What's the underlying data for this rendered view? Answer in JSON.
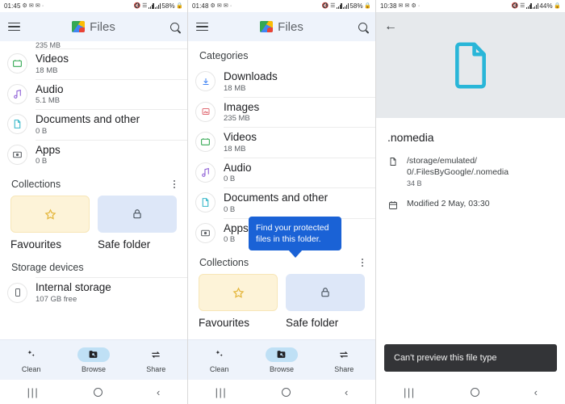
{
  "panel1": {
    "status": {
      "time": "01:45",
      "battery": "58%",
      "icons": [
        "alarm-icon",
        "message-icon",
        "message-icon",
        "dot-icon",
        "mute-icon",
        "wifi-icon",
        "signal-icon",
        "signal-icon",
        "battery-icon"
      ]
    },
    "appbar": {
      "menu": "menu-icon",
      "brand": "Files",
      "search": "search-icon"
    },
    "clipped_size": "235 MB",
    "categories": [
      {
        "title": "Videos",
        "size": "18 MB",
        "icon": "video-icon"
      },
      {
        "title": "Audio",
        "size": "5.1 MB",
        "icon": "audio-icon"
      },
      {
        "title": "Documents and other",
        "size": "0 B",
        "icon": "document-icon"
      },
      {
        "title": "Apps",
        "size": "0 B",
        "icon": "apps-icon"
      }
    ],
    "collections": {
      "title": "Collections",
      "menu": "overflow-menu-icon",
      "cards": [
        {
          "label": "Favourites",
          "icon": "star-icon"
        },
        {
          "label": "Safe folder",
          "icon": "lock-icon"
        }
      ]
    },
    "storage": {
      "title": "Storage devices",
      "items": [
        {
          "title": "Internal storage",
          "sub": "107 GB free",
          "icon": "phone-icon"
        }
      ]
    },
    "bottom_nav": [
      {
        "label": "Clean",
        "icon": "sparkle-icon",
        "selected": false
      },
      {
        "label": "Browse",
        "icon": "folder-search-icon",
        "selected": true
      },
      {
        "label": "Share",
        "icon": "share-arrows-icon",
        "selected": false
      }
    ],
    "sysnav": {
      "recent": "|||",
      "home": "home-icon",
      "back": "‹"
    }
  },
  "panel2": {
    "status": {
      "time": "01:48",
      "battery": "58%"
    },
    "appbar": {
      "brand": "Files"
    },
    "section_title": "Categories",
    "categories": [
      {
        "title": "Downloads",
        "size": "18 MB",
        "icon": "download-icon"
      },
      {
        "title": "Images",
        "size": "235 MB",
        "icon": "image-icon"
      },
      {
        "title": "Videos",
        "size": "18 MB",
        "icon": "video-icon"
      },
      {
        "title": "Audio",
        "size": "0 B",
        "icon": "audio-icon"
      },
      {
        "title": "Documents and other",
        "size": "0 B",
        "icon": "document-icon"
      },
      {
        "title": "Apps",
        "size": "0 B",
        "icon": "apps-icon"
      }
    ],
    "tooltip": "Find your protected files in this folder.",
    "collections": {
      "title": "Collections",
      "menu": "overflow-menu-icon",
      "cards": [
        {
          "label": "Favourites",
          "icon": "star-icon"
        },
        {
          "label": "Safe folder",
          "icon": "lock-icon"
        }
      ]
    },
    "bottom_nav": [
      {
        "label": "Clean",
        "icon": "sparkle-icon",
        "selected": false
      },
      {
        "label": "Browse",
        "icon": "folder-search-icon",
        "selected": true
      },
      {
        "label": "Share",
        "icon": "share-arrows-icon",
        "selected": false
      }
    ]
  },
  "panel3": {
    "status": {
      "time": "10:38",
      "battery": "44%"
    },
    "back": "back-arrow-icon",
    "preview_icon": "document-outline-icon",
    "file_name": ".nomedia",
    "path_line1": "/storage/emulated/",
    "path_line2": "0/.FilesByGoogle/.nomedia",
    "file_size": "34 B",
    "modified": "Modified 2 May, 03:30",
    "snackbar": "Can't preview this file type"
  },
  "colors": {
    "appbar_bg": "#eef3fb",
    "tooltip_blue": "#1a62d6",
    "selected_pill": "#bfe0f5",
    "fav_card": "#fdf3d8",
    "safe_card": "#dde7f8",
    "preview_bg": "#e6e9ec",
    "doc_cyan": "#29b6d8",
    "snackbar_bg": "#333437"
  }
}
